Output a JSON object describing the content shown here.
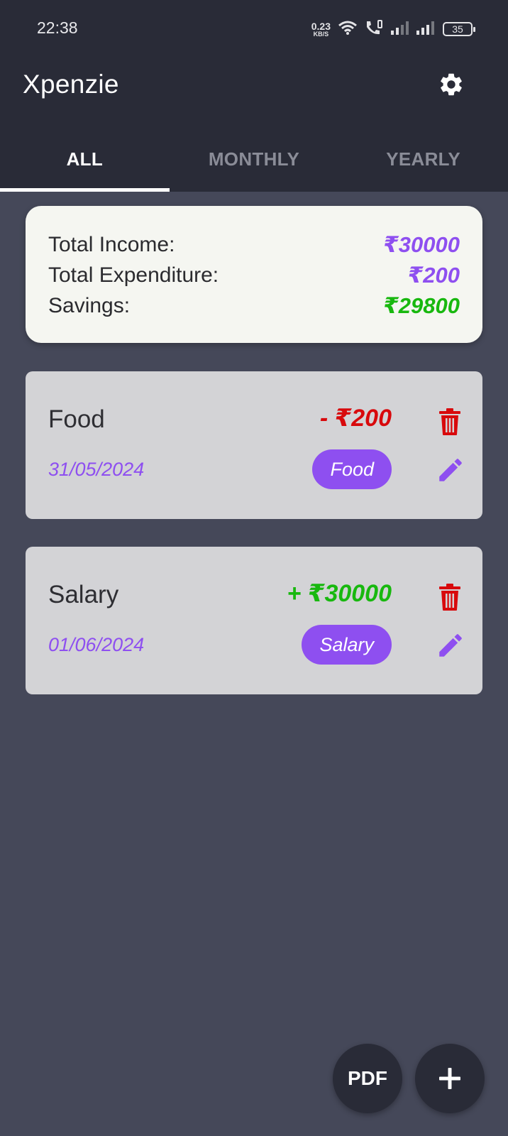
{
  "status_bar": {
    "time": "22:38",
    "net_speed_value": "0.23",
    "net_speed_unit": "KB/S",
    "battery": "35"
  },
  "app": {
    "title": "Xpenzie"
  },
  "tabs": [
    {
      "label": "ALL",
      "active": true
    },
    {
      "label": "MONTHLY",
      "active": false
    },
    {
      "label": "YEARLY",
      "active": false
    }
  ],
  "summary": {
    "income_label": "Total Income:",
    "income_value": "₹30000",
    "expenditure_label": "Total Expenditure:",
    "expenditure_value": "₹200",
    "savings_label": "Savings:",
    "savings_value": "₹29800"
  },
  "transactions": [
    {
      "title": "Food",
      "amount": "- ₹200",
      "date": "31/05/2024",
      "category": "Food",
      "type": "expense"
    },
    {
      "title": "Salary",
      "amount": "+ ₹30000",
      "date": "01/06/2024",
      "category": "Salary",
      "type": "income"
    }
  ],
  "fab": {
    "pdf_label": "PDF"
  },
  "colors": {
    "background": "#454859",
    "topbar": "#292b37",
    "purple": "#8e4ff0",
    "green": "#18b80f",
    "red": "#d8090c",
    "card": "#d3d3d6",
    "summary_card": "#f5f6f1"
  }
}
